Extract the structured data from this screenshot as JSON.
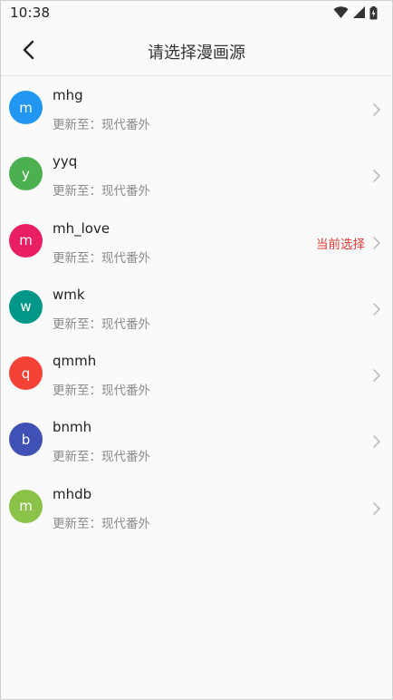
{
  "status_bar": {
    "time": "10:38",
    "icons": [
      "wifi-icon",
      "signal-icon",
      "battery-charging-icon"
    ]
  },
  "app_bar": {
    "back_icon": "arrow-back-icon",
    "title": "请选择漫画源"
  },
  "sources": [
    {
      "initial": "m",
      "name": "mhg",
      "update": "更新至：现代番外",
      "color": "#2196f3",
      "current": ""
    },
    {
      "initial": "y",
      "name": "yyq",
      "update": "更新至：现代番外",
      "color": "#4caf50",
      "current": ""
    },
    {
      "initial": "m",
      "name": "mh_love",
      "update": "更新至：现代番外",
      "color": "#e91e63",
      "current": "当前选择"
    },
    {
      "initial": "w",
      "name": "wmk",
      "update": "更新至：现代番外",
      "color": "#009688",
      "current": ""
    },
    {
      "initial": "q",
      "name": "qmmh",
      "update": "更新至：现代番外",
      "color": "#f44336",
      "current": ""
    },
    {
      "initial": "b",
      "name": "bnmh",
      "update": "更新至：现代番外",
      "color": "#3f51b5",
      "current": ""
    },
    {
      "initial": "m",
      "name": "mhdb",
      "update": "更新至：现代番外",
      "color": "#8bc34a",
      "current": ""
    }
  ]
}
